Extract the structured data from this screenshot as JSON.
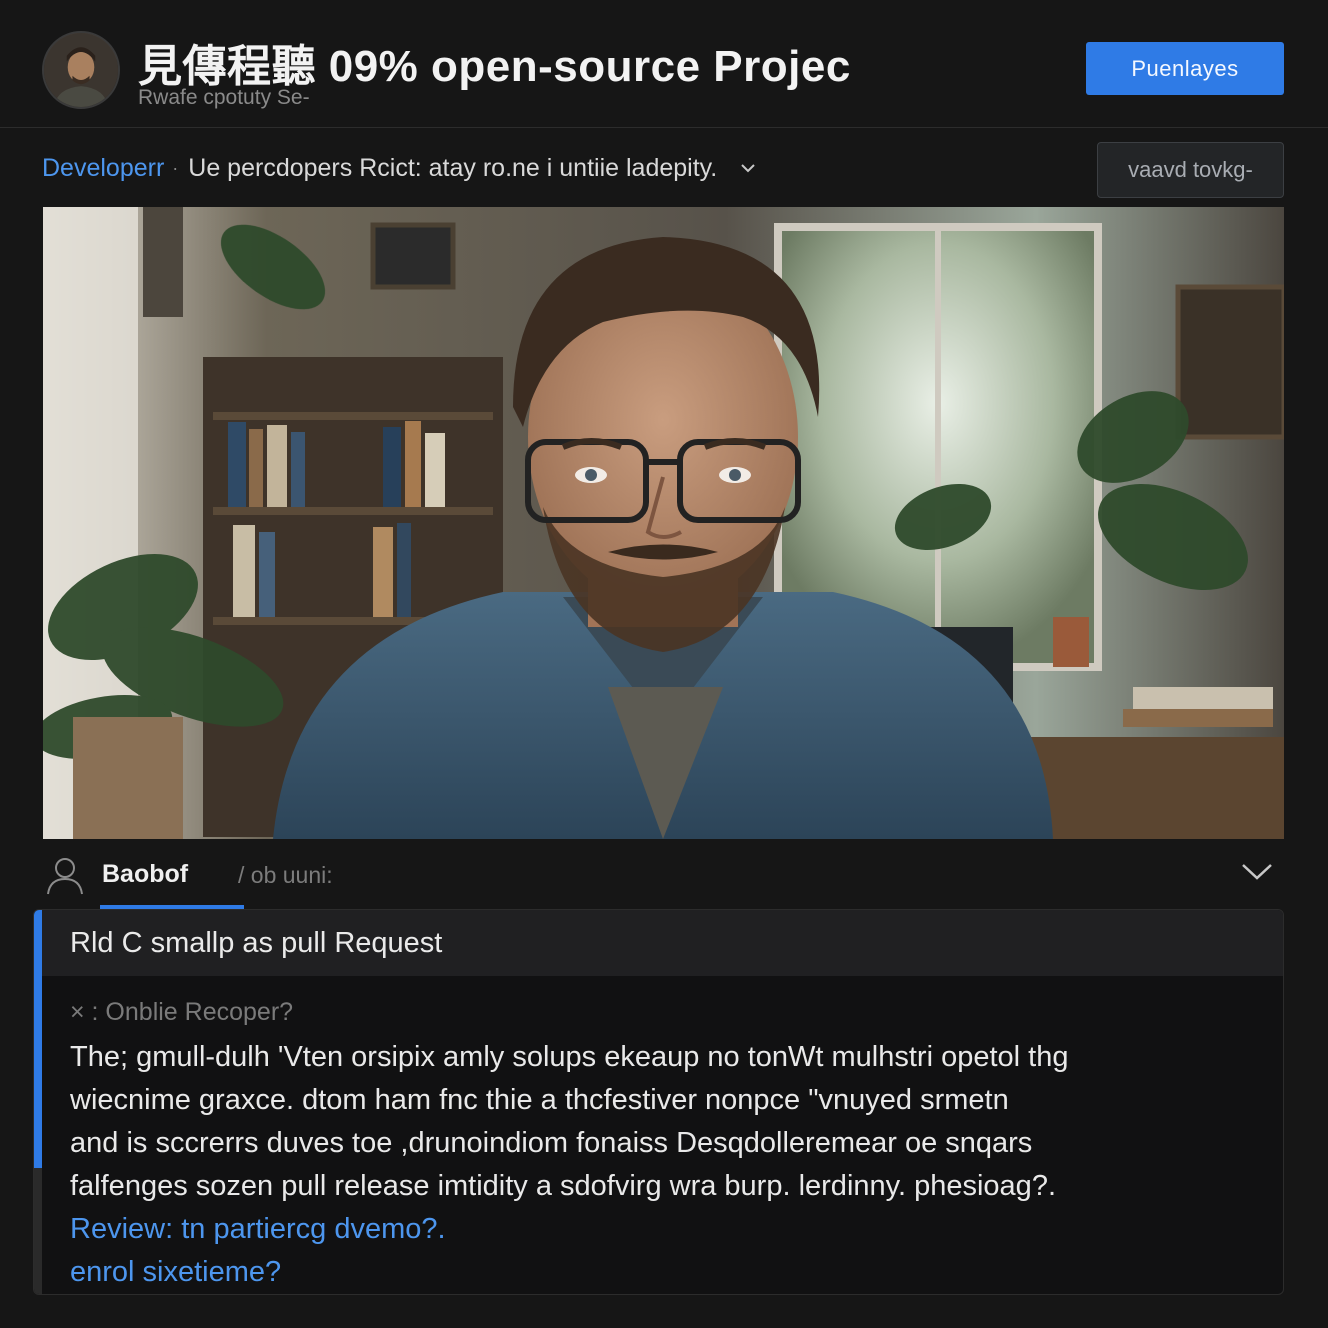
{
  "header": {
    "title": "見傳程聽 09% open-source Projec",
    "subtitle": "Rwafe cpotuty Se-",
    "primary_button": "Puenlayes",
    "avatar_icon": "user-avatar"
  },
  "breadcrumb": {
    "link": "Developerr",
    "separator": "·",
    "text": "Ue percdopers Rcict: atay ro.ne i untiie ladepity.",
    "chevron_icon": "chevron-down-icon",
    "secondary_button": "vaavd tovkg-"
  },
  "hero": {
    "icon": "developer-portrait-image"
  },
  "author": {
    "name": "Baobof",
    "meta": "/ ob uuni:",
    "user_icon": "user-icon",
    "collapse_icon": "chevron-down-icon"
  },
  "card": {
    "title": "Rld C  smallp as pull Request",
    "question": "× : Onblie Recoper?",
    "body_lines": [
      "The; gmull-dulh 'Vten orsipix amly solups ekeaup no tonWt mulhstri opetol thg",
      "wiecnime graxce. dtom ham fnc thie a thcfestiver nonpce \"vnuyed srmetn",
      "and is sccrerrs duves toe ,drunoindiom fonaiss Desqdolleremear oe snqars",
      "falfenges sozen pull release imtidity a sdofvirg wra burp. lerdinny. phesioag?."
    ],
    "links": [
      "Review: tn partiercg dvemo?.",
      "enrol sixetieme?"
    ]
  },
  "colors": {
    "accent": "#2f7be6",
    "link": "#4d96ee",
    "background": "#161616"
  }
}
